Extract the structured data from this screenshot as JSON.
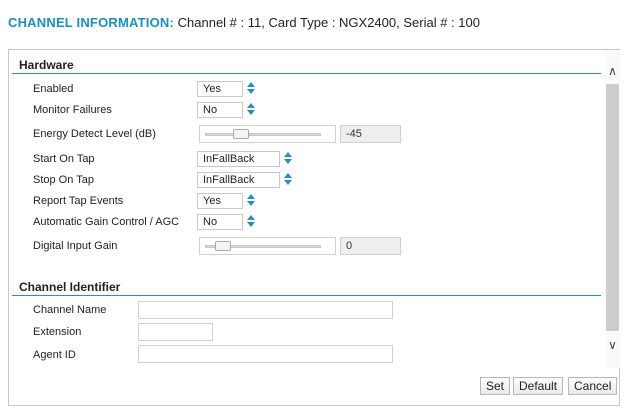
{
  "header": {
    "label": "CHANNEL INFORMATION:",
    "value": "Channel # : 11, Card Type : NGX2400, Serial # : 100"
  },
  "hardware": {
    "title": "Hardware",
    "enabled": {
      "label": "Enabled",
      "value": "Yes"
    },
    "monitor_failures": {
      "label": "Monitor Failures",
      "value": "No"
    },
    "energy_detect": {
      "label": "Energy Detect Level (dB)",
      "value": "-45",
      "slider_level": 0.28
    },
    "start_on_tap": {
      "label": "Start On Tap",
      "value": "InFallBack"
    },
    "stop_on_tap": {
      "label": "Stop On Tap",
      "value": "InFallBack"
    },
    "report_tap_events": {
      "label": "Report Tap Events",
      "value": "Yes"
    },
    "agc": {
      "label": "Automatic Gain Control / AGC",
      "value": "No"
    },
    "digital_input_gain": {
      "label": "Digital Input Gain",
      "value": "0",
      "slider_level": 0.1
    }
  },
  "channel_identifier": {
    "title": "Channel Identifier",
    "channel_name": {
      "label": "Channel Name",
      "value": ""
    },
    "extension": {
      "label": "Extension",
      "value": ""
    },
    "agent_id": {
      "label": "Agent ID",
      "value": ""
    }
  },
  "buttons": {
    "set": "Set",
    "default": "Default",
    "cancel": "Cancel"
  },
  "colors": {
    "accent": "#1c8fb8",
    "divider": "#2a8fb6"
  }
}
